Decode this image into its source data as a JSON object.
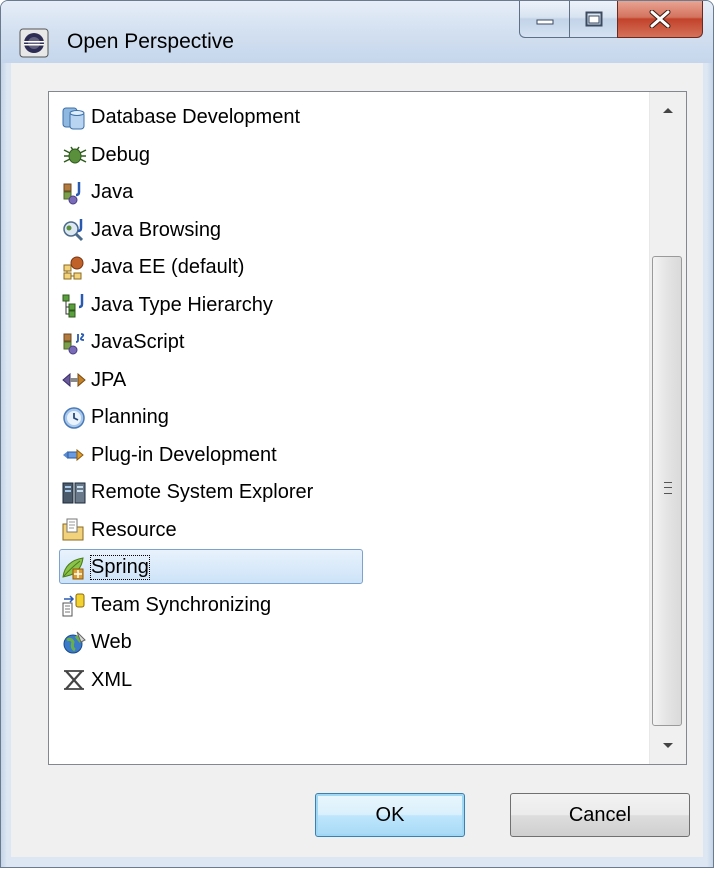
{
  "window": {
    "title": "Open Perspective",
    "app_icon": "eclipse-icon"
  },
  "perspectives": [
    {
      "label": "Database Development",
      "icon": "database-icon"
    },
    {
      "label": "Debug",
      "icon": "debug-bug-icon"
    },
    {
      "label": "Java",
      "icon": "java-icon"
    },
    {
      "label": "Java Browsing",
      "icon": "java-browsing-icon"
    },
    {
      "label": "Java EE (default)",
      "icon": "java-ee-icon"
    },
    {
      "label": "Java Type Hierarchy",
      "icon": "type-hierarchy-icon"
    },
    {
      "label": "JavaScript",
      "icon": "javascript-icon"
    },
    {
      "label": "JPA",
      "icon": "jpa-icon"
    },
    {
      "label": "Planning",
      "icon": "clock-icon"
    },
    {
      "label": "Plug-in Development",
      "icon": "plugin-icon"
    },
    {
      "label": "Remote System Explorer",
      "icon": "remote-system-icon"
    },
    {
      "label": "Resource",
      "icon": "resource-folder-icon"
    },
    {
      "label": "Spring",
      "icon": "spring-leaf-icon",
      "selected": true
    },
    {
      "label": "Team Synchronizing",
      "icon": "team-sync-icon"
    },
    {
      "label": "Web",
      "icon": "web-globe-icon"
    },
    {
      "label": "XML",
      "icon": "xml-icon"
    }
  ],
  "buttons": {
    "ok": "OK",
    "cancel": "Cancel"
  },
  "colors": {
    "selection_border": "#7da2ce",
    "selection_fill": "#cde3f8",
    "close_button": "#c2422b"
  }
}
